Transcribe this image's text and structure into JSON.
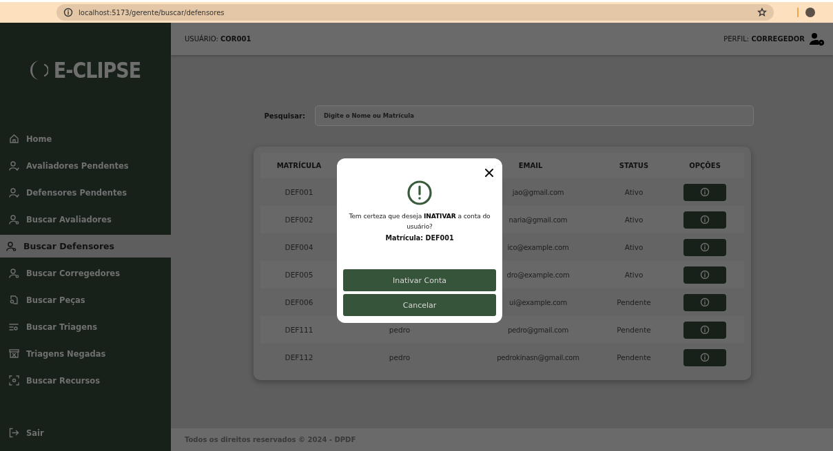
{
  "browser": {
    "url": "localhost:5173/gerente/buscar/defensores"
  },
  "sidebar": {
    "logo": "E-CLIPSE",
    "items": [
      {
        "label": "Home",
        "kind": "home",
        "selected": false
      },
      {
        "label": "Avaliadores Pendentes",
        "kind": "pending",
        "selected": false
      },
      {
        "label": "Defensores Pendentes",
        "kind": "pending",
        "selected": false
      },
      {
        "label": "Buscar Avaliadores",
        "kind": "people",
        "selected": false
      },
      {
        "label": "Buscar Defensores",
        "kind": "people",
        "selected": true
      },
      {
        "label": "Buscar Corregedores",
        "kind": "people",
        "selected": false
      },
      {
        "label": "Buscar Peças",
        "kind": "files",
        "selected": false
      },
      {
        "label": "Buscar Triagens",
        "kind": "list",
        "selected": false
      },
      {
        "label": "Triagens Negadas",
        "kind": "archive",
        "selected": false
      },
      {
        "label": "Buscar Recursos",
        "kind": "scan",
        "selected": false
      }
    ],
    "logout": "Sair"
  },
  "header": {
    "user_label": "USUÁRIO:",
    "user": "COR001",
    "profile_label": "PERFIL:",
    "profile": "CORREGEDOR"
  },
  "search": {
    "label": "Pesquisar:",
    "placeholder": "Digite o Nome ou Matrícula"
  },
  "table": {
    "columns": [
      "MATRÍCULA",
      "",
      "EMAIL",
      "STATUS",
      "OPÇÕES"
    ],
    "rows": [
      [
        "DEF001",
        "",
        "jao@gmail.com",
        "Ativo"
      ],
      [
        "DEF002",
        "",
        "naria@gmail.com",
        "Ativo"
      ],
      [
        "DEF004",
        "",
        "ico@example.com",
        "Ativo"
      ],
      [
        "DEF005",
        "",
        "dro@example.com",
        "Ativo"
      ],
      [
        "DEF006",
        "",
        "ui@example.com",
        "Pendente"
      ],
      [
        "DEF111",
        "pedro",
        "pedro@gmail.com",
        "Pendente"
      ],
      [
        "DEF112",
        "pedro",
        "pedrokinasn@gmail.com",
        "Pendente"
      ]
    ]
  },
  "modal": {
    "message": "Tem certeza que deseja **INATIVAR** a conta do usuário?",
    "detail": "Matrícula: DEF001",
    "buttons": [
      "Inativar Conta",
      "Cancelar"
    ]
  },
  "footer": "Todos os direitos reservados © 2024 - DPDF"
}
